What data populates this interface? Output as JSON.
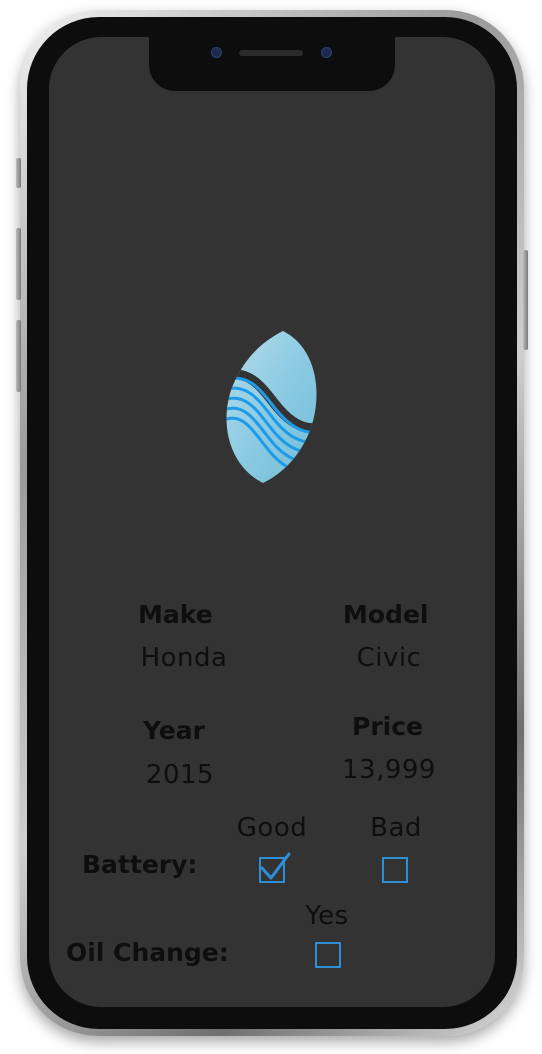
{
  "vehicle": {
    "make_label": "Make",
    "make_value": "Honda",
    "model_label": "Model",
    "model_value": "Civic",
    "year_label": "Year",
    "year_value": "2015",
    "price_label": "Price",
    "price_value": "13,999"
  },
  "battery": {
    "label": "Battery:",
    "good_label": "Good",
    "bad_label": "Bad",
    "good_checked": true,
    "bad_checked": false
  },
  "oil_change": {
    "label": "Oil Change:",
    "yes_label": "Yes",
    "yes_checked": false
  },
  "colors": {
    "screen_background": "#333333",
    "checkbox_accent": "#2e8fd6",
    "logo_light": "#8ccbe3",
    "logo_wave": "#1e9be8",
    "text": "#0e0e0e"
  },
  "icons": {
    "logo": "wave-leaf-logo-icon",
    "check": "checkmark-icon"
  }
}
